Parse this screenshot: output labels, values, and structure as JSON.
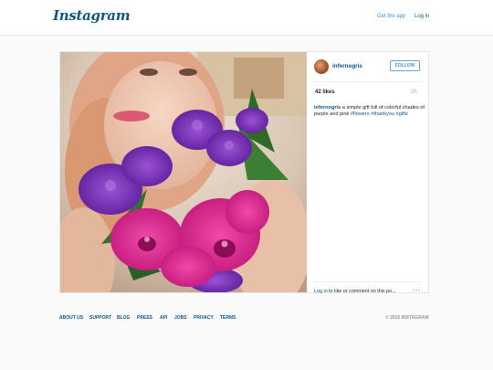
{
  "header": {
    "logo": "Instagram",
    "get_app": "Get the app",
    "login": "Log in"
  },
  "post": {
    "username": "infernogris",
    "follow_label": "FOLLOW",
    "likes": "42 likes",
    "time": "2h",
    "caption": {
      "user": "infernogris",
      "text": " a simple gift full of colorful shades of purple and pink ",
      "tags": [
        "#flowers",
        "#thankyou",
        "#gifts"
      ]
    },
    "comment_prompt": {
      "login": "Log in",
      "rest": " to like or comment on this po..."
    },
    "more": "•••"
  },
  "footer": {
    "links": [
      "ABOUT US",
      "SUPPORT",
      "BLOG",
      "PRESS",
      "API",
      "JOBS",
      "PRIVACY",
      "TERMS"
    ],
    "copyright": "© 2015 INSTAGRAM"
  },
  "colors": {
    "brand_blue": "#125688",
    "link_blue": "#3897f0",
    "orchid_magenta": "#d8238f",
    "orchid_purple": "#7b2fb0"
  },
  "icons": {
    "more": "more-dots-icon",
    "avatar": "user-avatar"
  }
}
